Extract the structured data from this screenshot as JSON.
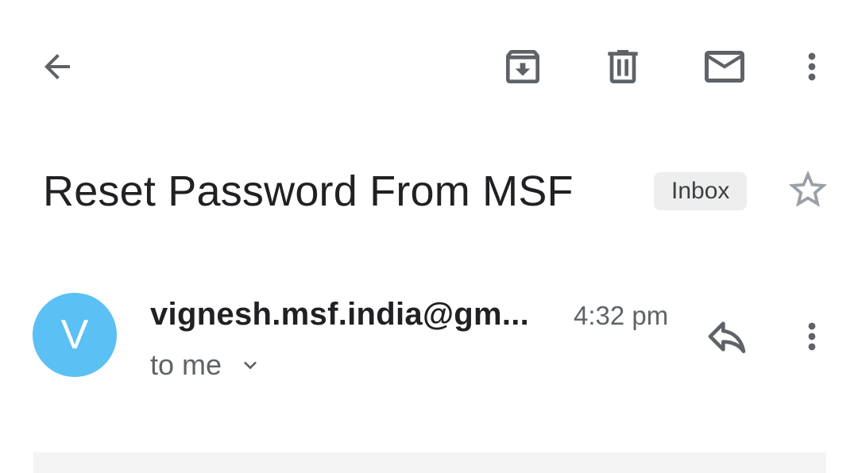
{
  "toolbar": {
    "back_icon": "arrow-back-icon",
    "archive_icon": "archive-icon",
    "delete_icon": "delete-icon",
    "mark_unread_icon": "mail-icon",
    "more_icon": "more-vert-icon"
  },
  "email": {
    "subject": "Reset Password From MSF",
    "label": "Inbox",
    "star_icon": "star-outline-icon",
    "sender": "vignesh.msf.india@gm...",
    "avatar_initial": "V",
    "avatar_color": "#5bc0f4",
    "time": "4:32 pm",
    "recipient": "to me",
    "recipient_icon": "chevron-down-icon",
    "reply_icon": "reply-icon",
    "more_icon": "more-vert-icon"
  },
  "colors": {
    "icon": "#5f6368",
    "text_primary": "#202124",
    "text_secondary": "#5f6368",
    "badge_bg": "#eeeeee"
  }
}
